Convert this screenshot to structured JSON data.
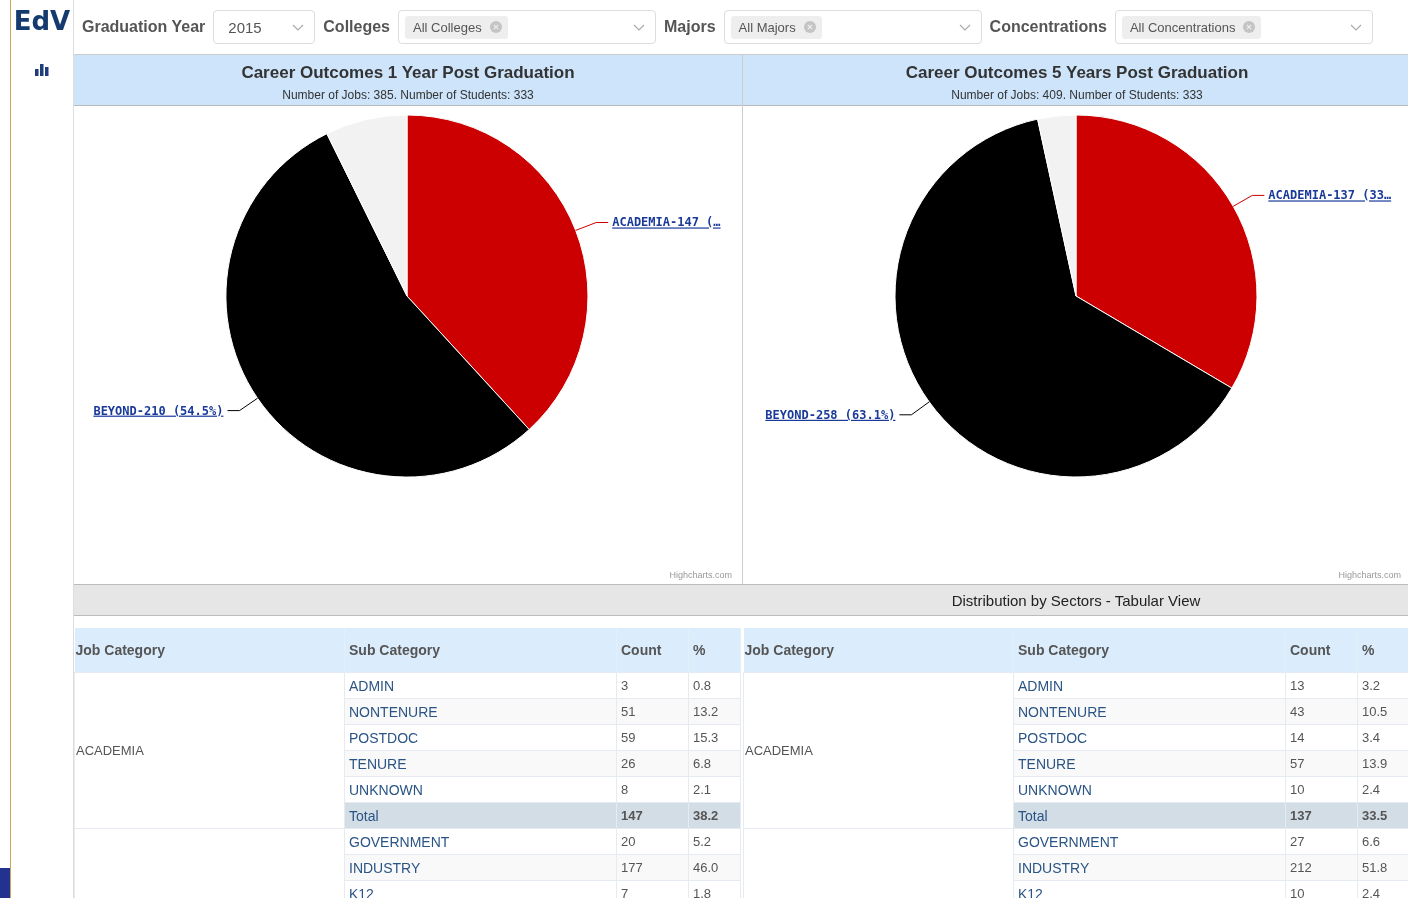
{
  "logo": "EdV",
  "filters": [
    {
      "label": "Graduation Year",
      "kind": "select",
      "value": "2015"
    },
    {
      "label": "Colleges",
      "kind": "multi",
      "tag": "All Colleges"
    },
    {
      "label": "Majors",
      "kind": "multi",
      "tag": "All Majors"
    },
    {
      "label": "Concentrations",
      "kind": "multi",
      "tag": "All Concentrations"
    }
  ],
  "charts": [
    {
      "title": "Career Outcomes 1 Year Post Graduation",
      "subtitle": "Number of Jobs: 385. Number of Students: 333",
      "credit": "Highcharts.com",
      "chart_data": {
        "type": "pie",
        "values": [
          38.2,
          54.5,
          7.3
        ],
        "colors": [
          "#cc0000",
          "#000000",
          "#f2f2f2"
        ],
        "value_labels": [
          "ACADEMIA-147 (…",
          "BEYOND-210 (54.5%)",
          null
        ]
      }
    },
    {
      "title": "Career Outcomes 5 Years Post Graduation",
      "subtitle": "Number of Jobs: 409. Number of Students: 333",
      "credit": "Highcharts.com",
      "chart_data": {
        "type": "pie",
        "values": [
          33.5,
          63.1,
          3.4
        ],
        "colors": [
          "#cc0000",
          "#000000",
          "#f2f2f2"
        ],
        "value_labels": [
          "ACADEMIA-137 (33…",
          "BEYOND-258 (63.1%)",
          null
        ]
      }
    }
  ],
  "section_title": "Distribution by Sectors - Tabular View",
  "tables": [
    {
      "columns": [
        "Job Category",
        "Sub Category",
        "Count",
        "%"
      ],
      "groups": [
        {
          "job_category": "ACADEMIA",
          "rows": [
            {
              "kind": "item",
              "sub": "ADMIN",
              "count": "3",
              "pct": "0.8"
            },
            {
              "kind": "item",
              "sub": "NONTENURE",
              "count": "51",
              "pct": "13.2"
            },
            {
              "kind": "item",
              "sub": "POSTDOC",
              "count": "59",
              "pct": "15.3"
            },
            {
              "kind": "item",
              "sub": "TENURE",
              "count": "26",
              "pct": "6.8"
            },
            {
              "kind": "item",
              "sub": "UNKNOWN",
              "count": "8",
              "pct": "2.1"
            },
            {
              "kind": "total",
              "sub": "Total",
              "count": "147",
              "pct": "38.2"
            }
          ]
        },
        {
          "rows": [
            {
              "kind": "item",
              "sub": "GOVERNMENT",
              "count": "20",
              "pct": "5.2"
            },
            {
              "kind": "item",
              "sub": "INDUSTRY",
              "count": "177",
              "pct": "46.0"
            },
            {
              "kind": "item",
              "sub": "K12",
              "count": "7",
              "pct": "1.8"
            }
          ]
        }
      ]
    },
    {
      "columns": [
        "Job Category",
        "Sub Category",
        "Count",
        "%"
      ],
      "groups": [
        {
          "job_category": "ACADEMIA",
          "rows": [
            {
              "kind": "item",
              "sub": "ADMIN",
              "count": "13",
              "pct": "3.2"
            },
            {
              "kind": "item",
              "sub": "NONTENURE",
              "count": "43",
              "pct": "10.5"
            },
            {
              "kind": "item",
              "sub": "POSTDOC",
              "count": "14",
              "pct": "3.4"
            },
            {
              "kind": "item",
              "sub": "TENURE",
              "count": "57",
              "pct": "13.9"
            },
            {
              "kind": "item",
              "sub": "UNKNOWN",
              "count": "10",
              "pct": "2.4"
            },
            {
              "kind": "total",
              "sub": "Total",
              "count": "137",
              "pct": "33.5"
            }
          ]
        },
        {
          "rows": [
            {
              "kind": "item",
              "sub": "GOVERNMENT",
              "count": "27",
              "pct": "6.6"
            },
            {
              "kind": "item",
              "sub": "INDUSTRY",
              "count": "212",
              "pct": "51.8"
            },
            {
              "kind": "item",
              "sub": "K12",
              "count": "10",
              "pct": "2.4"
            }
          ]
        }
      ]
    }
  ]
}
